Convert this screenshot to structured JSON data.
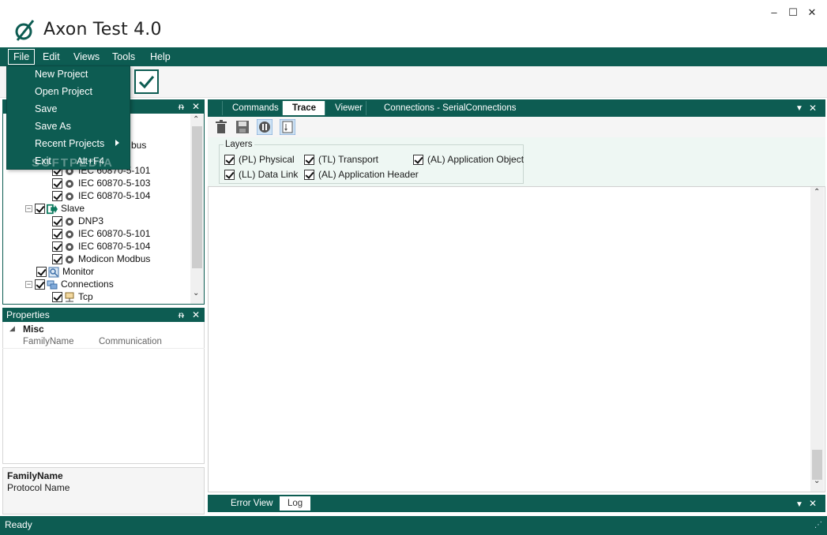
{
  "window": {
    "title": "Axon Test 4.0",
    "minimize": "–",
    "maximize": "☐",
    "close": "✕"
  },
  "menu": {
    "file": "File",
    "edit": "Edit",
    "views": "Views",
    "tools": "Tools",
    "help": "Help"
  },
  "file_menu": {
    "new_project": "New Project",
    "open_project": "Open Project",
    "save": "Save",
    "save_as": "Save As",
    "recent_projects": "Recent Projects",
    "exit": "Exit",
    "exit_shortcut": "Alt+F4"
  },
  "watermark": "SOFTPEDIA",
  "tree_panel": {
    "pin": "ᵰ",
    "close": "✕",
    "partial_item": "bus",
    "items": [
      {
        "label": "IEC 60870-5-101"
      },
      {
        "label": "IEC 60870-5-103"
      },
      {
        "label": "IEC 60870-5-104"
      },
      {
        "label": "Slave"
      },
      {
        "label": "DNP3"
      },
      {
        "label": "IEC 60870-5-101"
      },
      {
        "label": "IEC 60870-5-104"
      },
      {
        "label": "Modicon Modbus"
      },
      {
        "label": "Monitor"
      },
      {
        "label": "Connections"
      },
      {
        "label": "Tcp"
      }
    ]
  },
  "properties": {
    "title": "Properties",
    "category": "Misc",
    "rows": [
      {
        "name": "FamilyName",
        "value": "Communication"
      }
    ],
    "desc_title": "FamilyName",
    "desc_text": "Protocol Name"
  },
  "main_tabs": [
    "Commands",
    "Trace",
    "Viewer",
    "Connections - SerialConnections"
  ],
  "layers": {
    "title": "Layers",
    "items": [
      "(PL) Physical",
      "(TL) Transport",
      "(AL) Application Object",
      "(LL) Data Link",
      "(AL) Application Header"
    ]
  },
  "bottom_tabs": [
    "Error View",
    "Log"
  ],
  "status": "Ready",
  "colors": {
    "primary": "#0d5c52",
    "surface": "#f5f5f5"
  }
}
